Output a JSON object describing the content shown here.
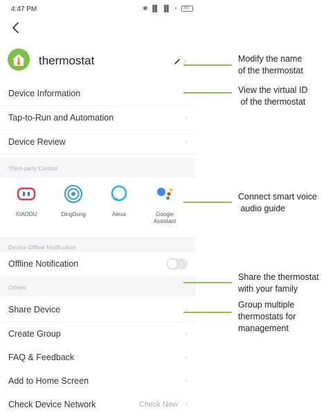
{
  "status_bar": {
    "time": "4:47 PM",
    "signal": "✱ ▐▌ ▐▌ ◔",
    "battery": "80"
  },
  "device": {
    "name": "thermostat"
  },
  "menu": {
    "device_information": "Device Information",
    "tap_to_run": "Tap-to-Run and Automation",
    "device_review": "Device Review"
  },
  "sections": {
    "third_party": "Third-party Control",
    "offline": "Device Offline Notification",
    "others": "Others"
  },
  "third_party_items": [
    {
      "name": "XIAODU",
      "icon": "xiaodu-icon"
    },
    {
      "name": "DingDong",
      "icon": "dingdong-icon"
    },
    {
      "name": "Alexa",
      "icon": "alexa-icon"
    },
    {
      "name": "Google\nAssistant",
      "icon": "google-assistant-icon"
    }
  ],
  "offline": {
    "label": "Offline Notification",
    "enabled": false
  },
  "others": {
    "share_device": "Share Device",
    "create_group": "Create Group",
    "faq": "FAQ & Feedback",
    "add_home": "Add to Home Screen",
    "check_network": "Check Device Network",
    "check_now": "Check Now"
  },
  "chevron": "›",
  "callouts": {
    "modify_name": "Modify the name\nof the thermostat",
    "virtual_id": "View the virtual ID\n of the thermostat",
    "voice": "Connect smart voice\n audio guide",
    "share": "Share the thermostat\nwith your family",
    "group": "Group multiple\nthermostats for\nmanagement"
  },
  "colors": {
    "accent_green": "#8cc63f",
    "section_bg": "#f5f5f7"
  }
}
